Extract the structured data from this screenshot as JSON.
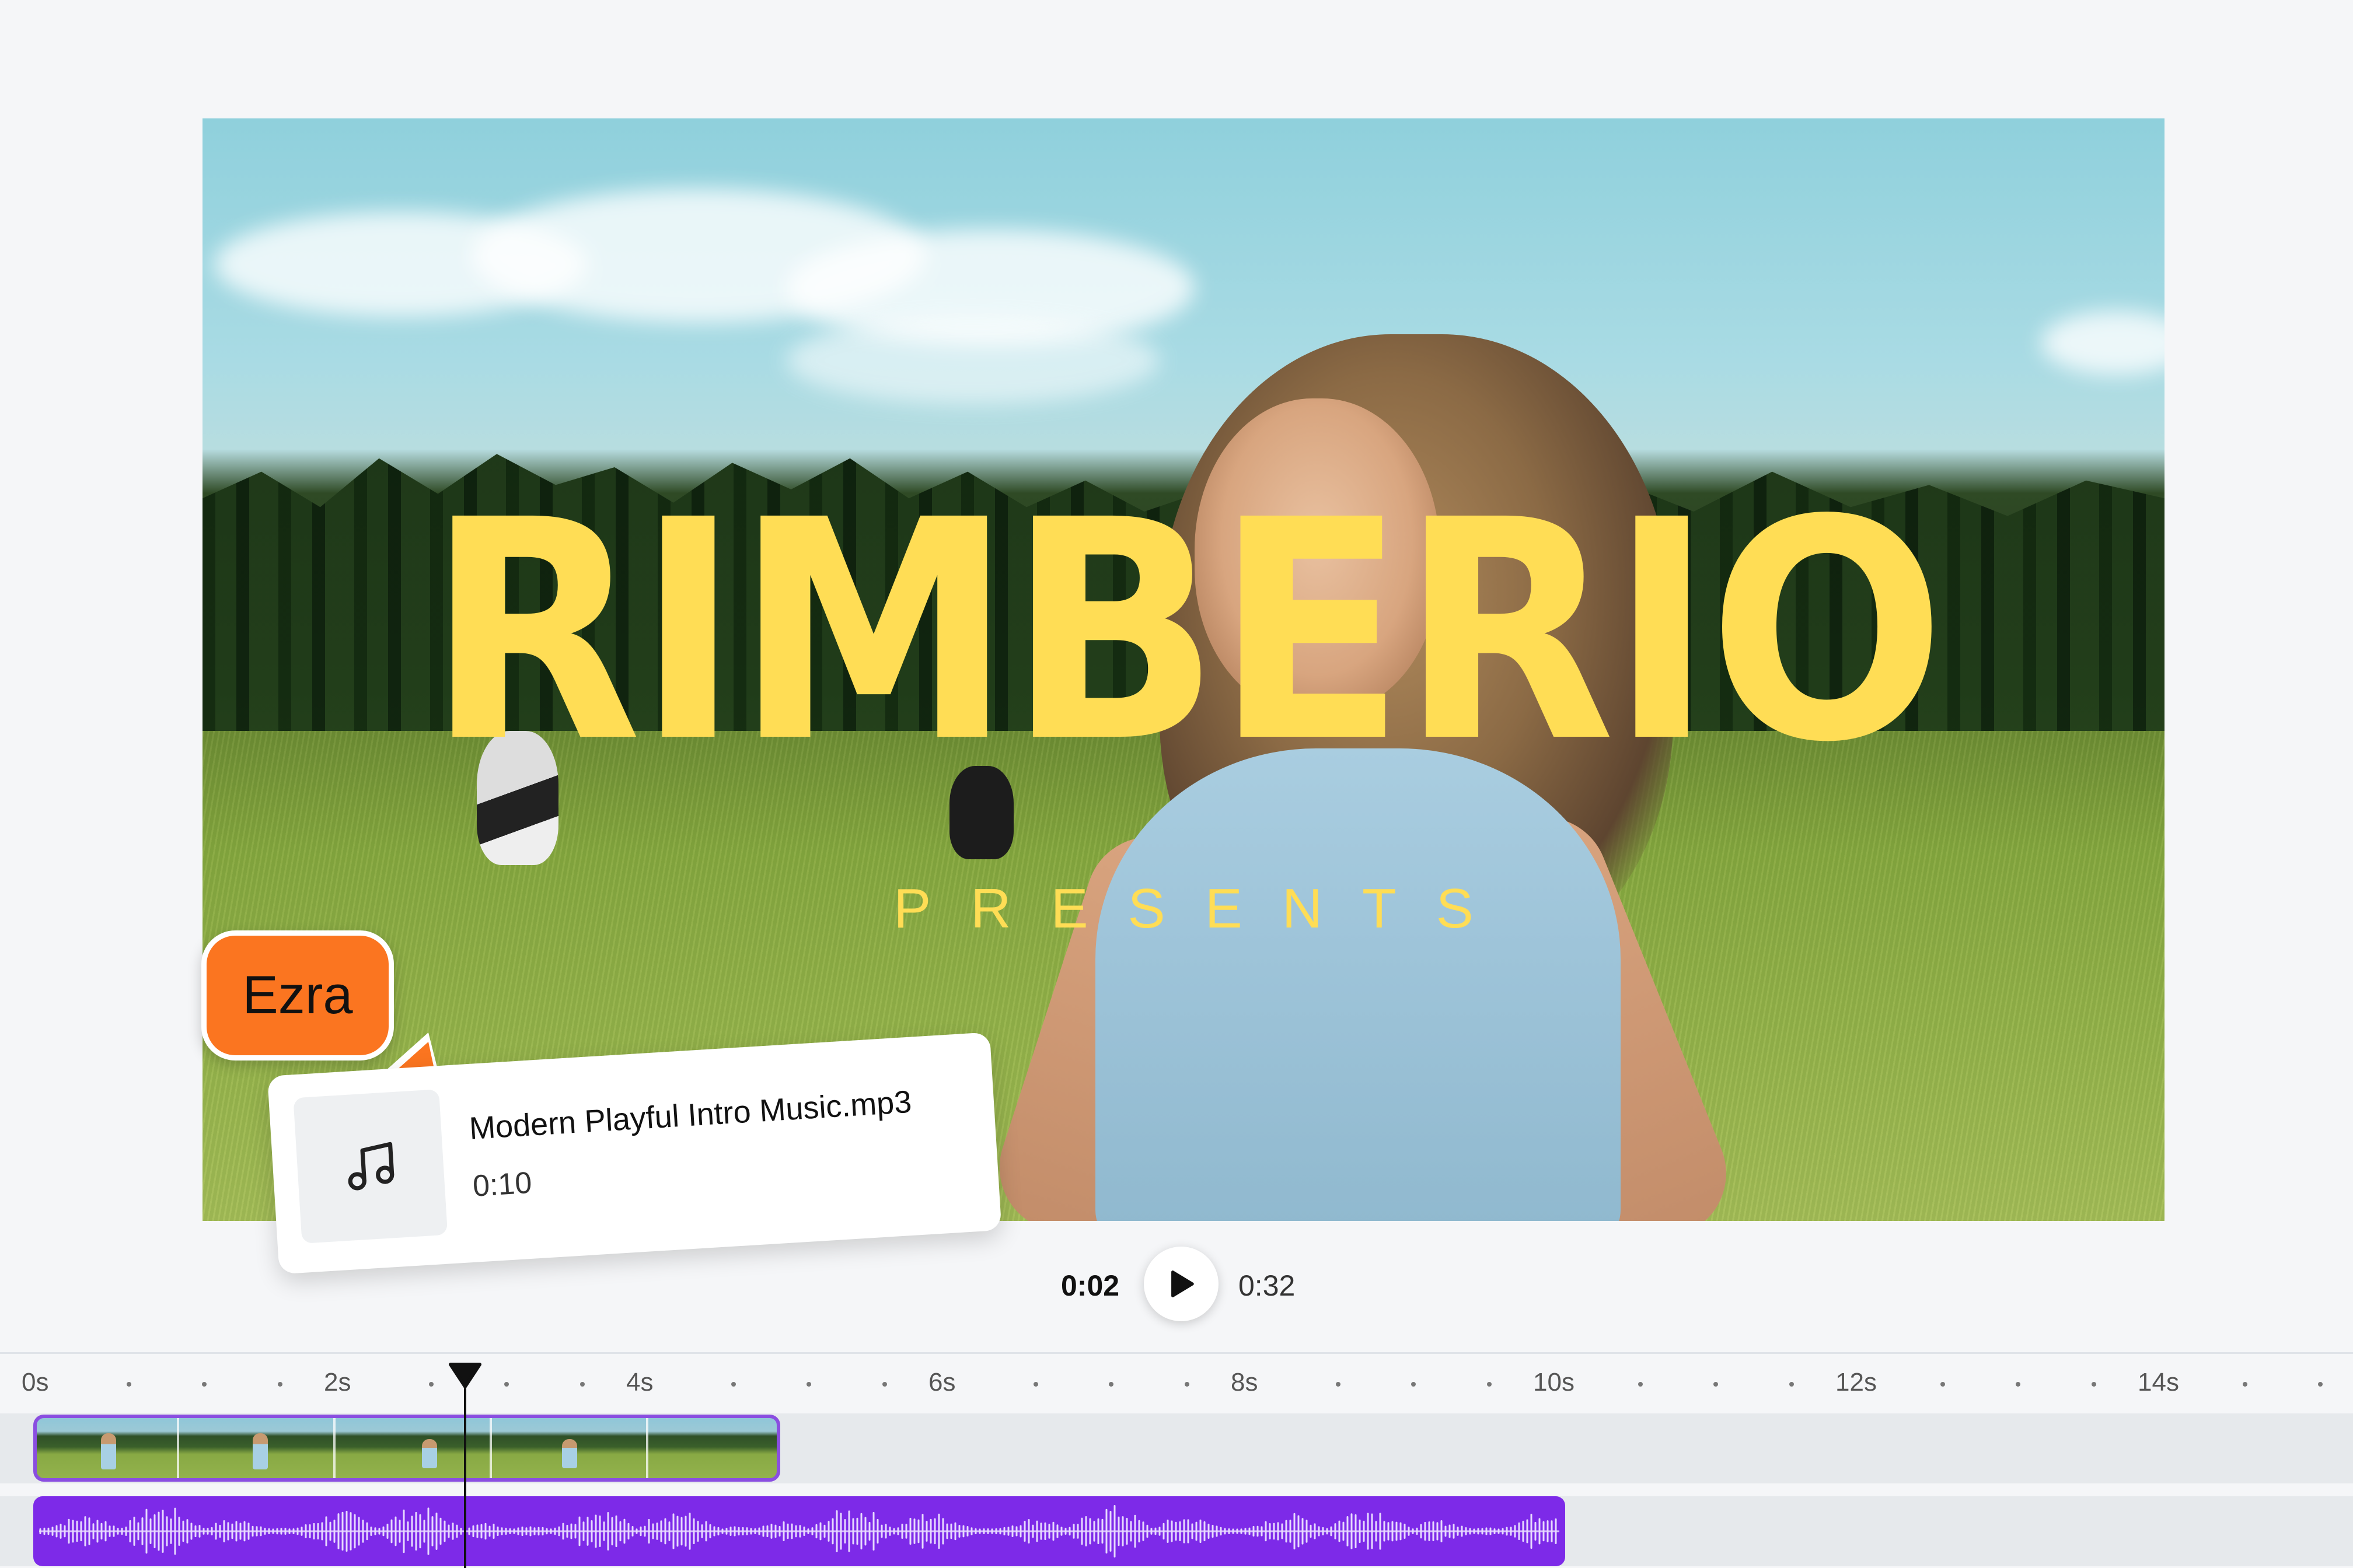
{
  "canvas": {
    "title": "RIMBERIO",
    "subtitle": "PRESENTS"
  },
  "collaborator": {
    "name": "Ezra",
    "color": "#fb7520"
  },
  "audio_card": {
    "file_name": "Modern Playful Intro Music.mp3",
    "duration": "0:10",
    "icon": "music-note-icon"
  },
  "playback": {
    "current_time": "0:02",
    "total_time": "0:32",
    "play_icon": "play-icon"
  },
  "timeline": {
    "tick_labels": [
      "0s",
      "2s",
      "4s",
      "6s",
      "8s",
      "10s",
      "12s",
      "14s"
    ],
    "playhead_seconds": 2.8,
    "video_clip_seconds": [
      0,
      4.9
    ],
    "audio_clip_seconds": [
      0,
      10
    ],
    "accent_color": "#7d2ae8"
  },
  "colors": {
    "title_yellow": "#ffdd55",
    "background": "#f5f6f8"
  }
}
